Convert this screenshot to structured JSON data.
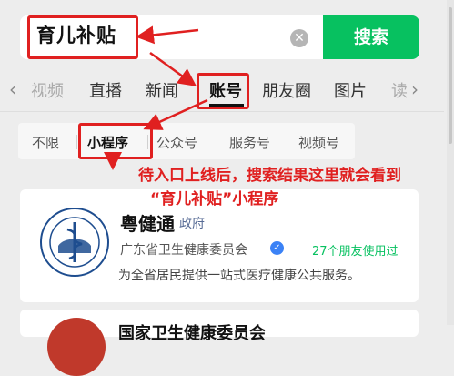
{
  "search": {
    "query": "育儿补贴",
    "button_label": "搜索"
  },
  "tabs": [
    {
      "label": "视频"
    },
    {
      "label": "直播"
    },
    {
      "label": "新闻"
    },
    {
      "label": "账号"
    },
    {
      "label": "朋友圈"
    },
    {
      "label": "图片"
    },
    {
      "label": "读"
    }
  ],
  "filters": [
    {
      "label": "不限"
    },
    {
      "label": "小程序"
    },
    {
      "label": "公众号"
    },
    {
      "label": "服务号"
    },
    {
      "label": "视频号"
    }
  ],
  "annotation": {
    "line1": "待入口上线后，搜索结果这里就会看到",
    "line2": "“育儿补贴”小程序"
  },
  "result": {
    "name": "粤健通",
    "tag": "政府",
    "org": "广东省卫生健康委员会",
    "friends": "27个朋友使用过",
    "desc": "为全省居民提供一站式医疗健康公共服务。"
  },
  "result2": {
    "name": "国家卫生健康委员会"
  },
  "colors": {
    "accent_green": "#07c160",
    "annotation_red": "#e02020",
    "link_blue": "#576b95"
  }
}
